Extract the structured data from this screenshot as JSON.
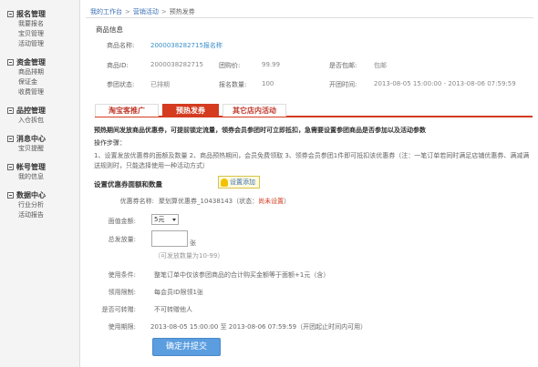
{
  "sidebar": {
    "groups": [
      {
        "title": "报名管理",
        "items": [
          "我要报名",
          "宝贝管理",
          "活动管理"
        ]
      },
      {
        "title": "资金管理",
        "items": [
          "商品排期",
          "保证金",
          "收费管理"
        ]
      },
      {
        "title": "品控管理",
        "items": [
          "入仓拆包"
        ]
      },
      {
        "title": "消息中心",
        "items": [
          "宝贝提醒"
        ]
      },
      {
        "title": "帐号管理",
        "items": [
          "我的信息"
        ]
      },
      {
        "title": "数据中心",
        "items": [
          "行业分析",
          "活动报告"
        ]
      }
    ]
  },
  "breadcrumb": {
    "home": "我的工作台",
    "level2": "营销活动",
    "current": "预热发券"
  },
  "product_info": {
    "section_title": "商品信息",
    "name_label": "商品名称:",
    "name_value": "2000038282715报名称",
    "id_label": "商品ID:",
    "id_value": "2000038282715",
    "group_price_label": "团购价:",
    "group_price_value": "99.99",
    "shipping_label": "是否包邮:",
    "shipping_value": "包邮",
    "status_label": "参团状态:",
    "status_value": "已排期",
    "count_label": "报名数量:",
    "count_value": "100",
    "open_time_label": "开团时间:",
    "open_time_value": "2013-08-05 15:00:00 - 2013-08-06 07:59:59"
  },
  "tabs": [
    "淘宝客推广",
    "预热发券",
    "其它店内活动"
  ],
  "notice": "预热期间发放商品优惠券，可提前锁定流量，领券会员参团时可立即抵扣，急需要设置参团商品是否参加以及活动参数",
  "steps_title": "操作步骤：",
  "steps_text": "1、设置发放优惠券的面额及数量 2、商品预热期间，会员免费领取 3、领券会员参团1件即可抵扣该优惠券（注：一笔订单若同时满足店铺优惠券、满减满送规则时，只能选择使用一种活动方式）",
  "coupon": {
    "section_title": "设置优惠券面额和数量",
    "help_label": "设置添加",
    "name_label": "优惠券名称:",
    "name_value": "聚划算优惠券_10438143（状态：",
    "status_value": "尚未设置",
    "status_close": "）",
    "amount_label": "面值金额:",
    "amount_value": "5元",
    "quantity_label": "总发放量:",
    "quantity_unit": "张",
    "quantity_hint": "（可发放数量为10-99）",
    "condition_label": "使用条件:",
    "condition_value": "整笔订单中仅该参团商品的合计购买金额等于面额+1元（含）",
    "limit_label": "领用限制:",
    "limit_value": "每会员ID限领1张",
    "transfer_label": "是否可转赠:",
    "transfer_value": "不可转赠他人",
    "period_label": "使用期限:",
    "period_value": "2013-08-05 15:00:00 至 2013-08-06 07:59:59（开团起止时间内可用）",
    "submit_label": "确定并提交"
  }
}
